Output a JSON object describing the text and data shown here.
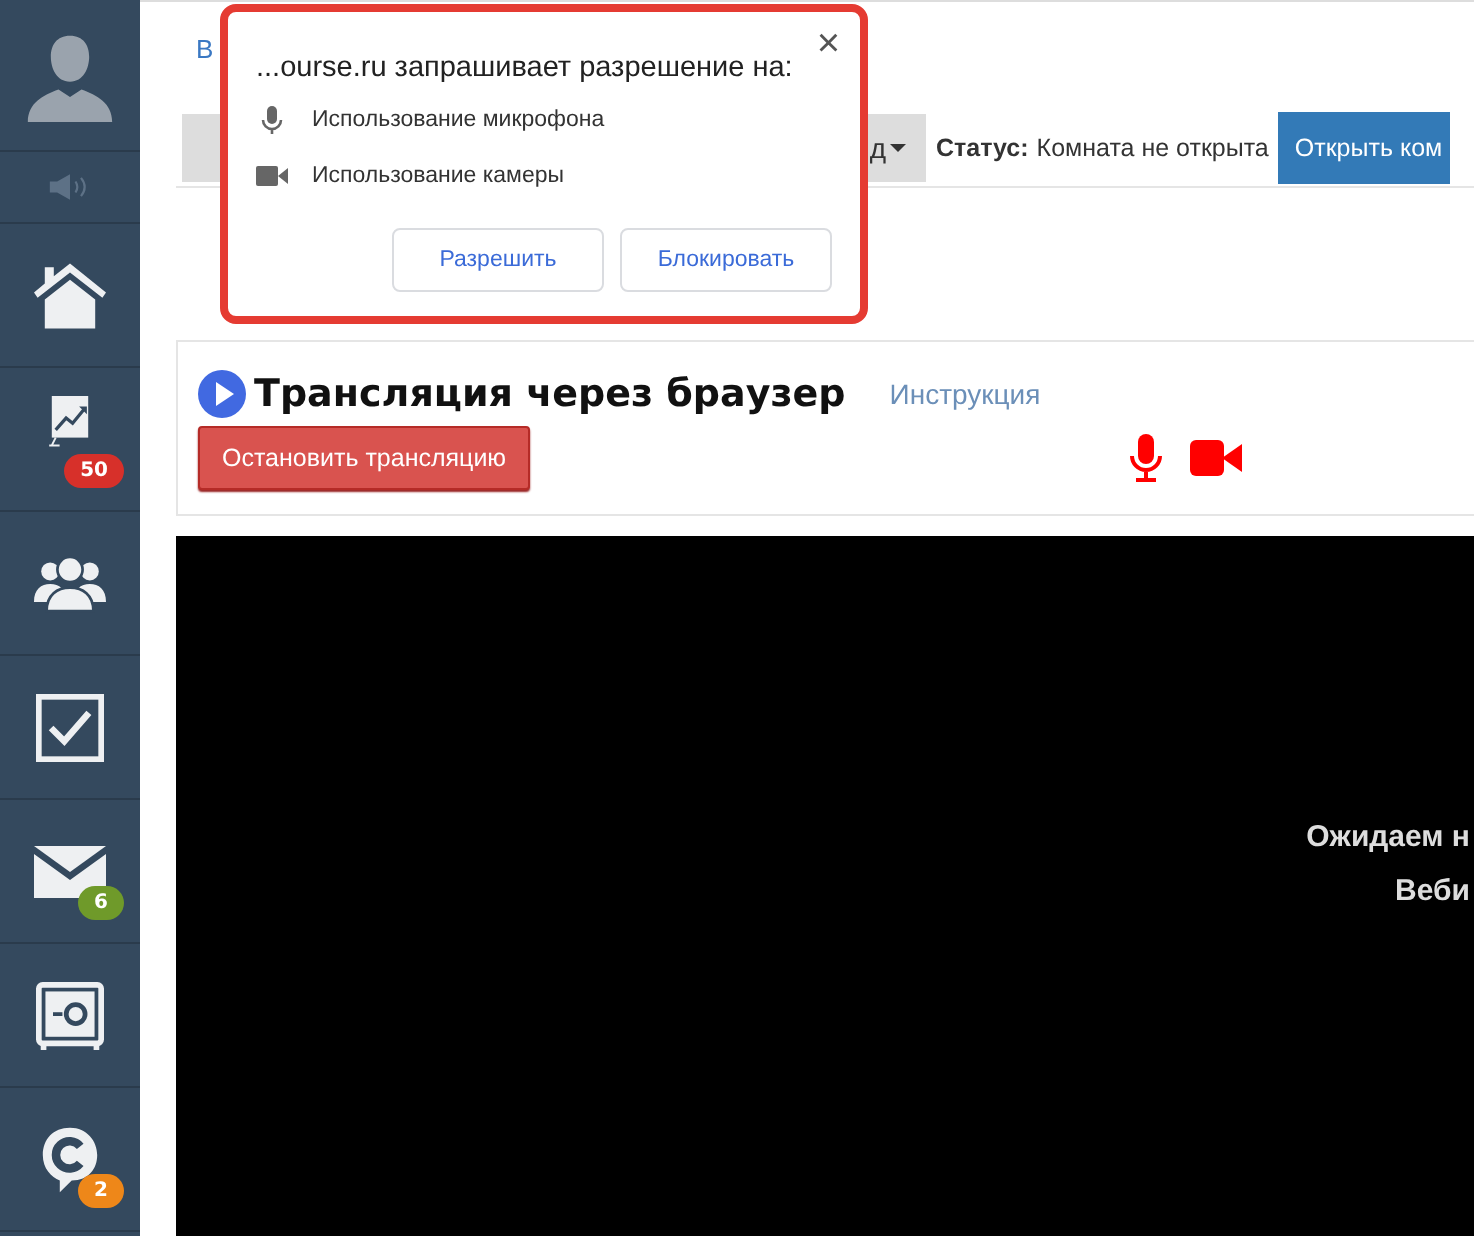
{
  "sidebar": {
    "items": [
      {
        "kind": "avatar"
      },
      {
        "kind": "speaker"
      },
      {
        "kind": "home"
      },
      {
        "kind": "chart",
        "badge": {
          "text": "50",
          "color": "#d7302a"
        }
      },
      {
        "kind": "people"
      },
      {
        "kind": "tasks"
      },
      {
        "kind": "mail",
        "badge": {
          "text": "6",
          "color": "#6f9a2a"
        }
      },
      {
        "kind": "safe"
      },
      {
        "kind": "chat",
        "badge": {
          "text": "2",
          "color": "#ee8719"
        }
      }
    ]
  },
  "breadcrumb": "В",
  "toolbar": {
    "menu_button": "д",
    "status_label": "Статус:",
    "status_value": "Комната не открыта",
    "open_button": "Открыть ком"
  },
  "broadcast": {
    "title": "Трансляция через браузер",
    "help_link": "Инструкция",
    "stop_button": "Остановить трансляцию",
    "mic_on": true,
    "camera_on": true
  },
  "video": {
    "lines": [
      "Ожидаем н",
      "Веби"
    ]
  },
  "permission_popup": {
    "title": "...ourse.ru запрашивает разрешение на:",
    "close": "×",
    "permissions": [
      {
        "kind": "microphone",
        "label": "Использование микрофона"
      },
      {
        "kind": "camera",
        "label": "Использование камеры"
      }
    ],
    "buttons": [
      "Разрешить",
      "Блокировать"
    ]
  }
}
